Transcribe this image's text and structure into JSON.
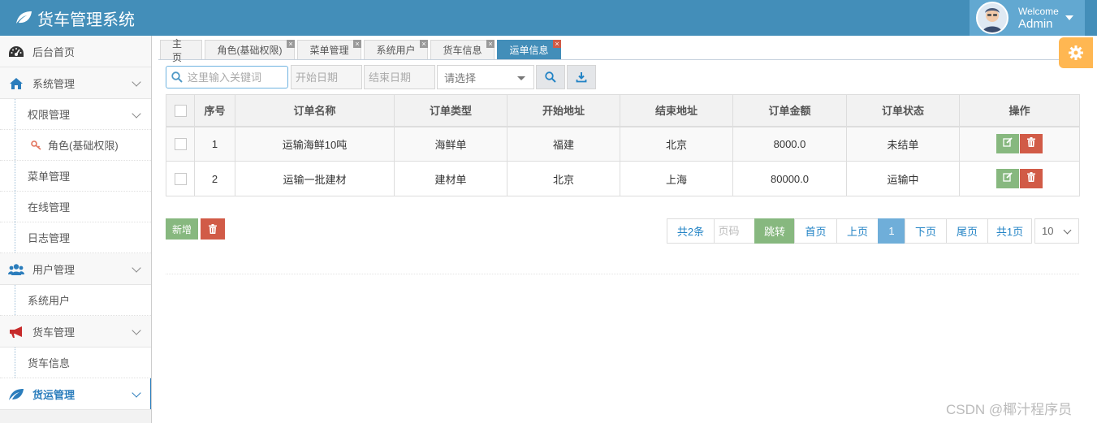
{
  "header": {
    "title": "货车管理系统",
    "welcome": "Welcome",
    "username": "Admin",
    "bg_color": "#438eb9",
    "user_bg_color": "#62a8d1"
  },
  "sidebar": {
    "items": [
      {
        "label": "后台首页",
        "icon": "dashboard-icon"
      },
      {
        "label": "系统管理",
        "icon": "home-icon"
      },
      {
        "label": "权限管理"
      },
      {
        "label": "角色(基础权限)",
        "icon": "key-icon"
      },
      {
        "label": "菜单管理"
      },
      {
        "label": "在线管理"
      },
      {
        "label": "日志管理"
      },
      {
        "label": "用户管理",
        "icon": "users-icon"
      },
      {
        "label": "系统用户"
      },
      {
        "label": "货车管理",
        "icon": "bullhorn-icon"
      },
      {
        "label": "货车信息"
      },
      {
        "label": "货运管理",
        "icon": "leaf-icon"
      }
    ]
  },
  "tabs": [
    {
      "label": "主页"
    },
    {
      "label": "角色(基础权限)"
    },
    {
      "label": "菜单管理"
    },
    {
      "label": "系统用户"
    },
    {
      "label": "货车信息"
    },
    {
      "label": "运单信息"
    }
  ],
  "toolbar": {
    "search_placeholder": "这里输入关键词",
    "start_date_placeholder": "开始日期",
    "end_date_placeholder": "结束日期",
    "select_placeholder": "请选择"
  },
  "table": {
    "columns": [
      "序号",
      "订单名称",
      "订单类型",
      "开始地址",
      "结束地址",
      "订单金额",
      "订单状态",
      "操作"
    ],
    "rows": [
      {
        "no": "1",
        "name": "运输海鲜10吨",
        "type": "海鲜单",
        "from": "福建",
        "to": "北京",
        "amount": "8000.0",
        "status": "未结单"
      },
      {
        "no": "2",
        "name": "运输一批建材",
        "type": "建材单",
        "from": "北京",
        "to": "上海",
        "amount": "80000.0",
        "status": "运输中"
      }
    ]
  },
  "actions": {
    "add_label": "新增"
  },
  "pagination": {
    "total": "共2条",
    "page_input_placeholder": "页码",
    "jump": "跳转",
    "first": "首页",
    "prev": "上页",
    "current": "1",
    "next": "下页",
    "last": "尾页",
    "pages": "共1页",
    "page_size": "10"
  },
  "watermark": "CSDN @椰汁程序员"
}
